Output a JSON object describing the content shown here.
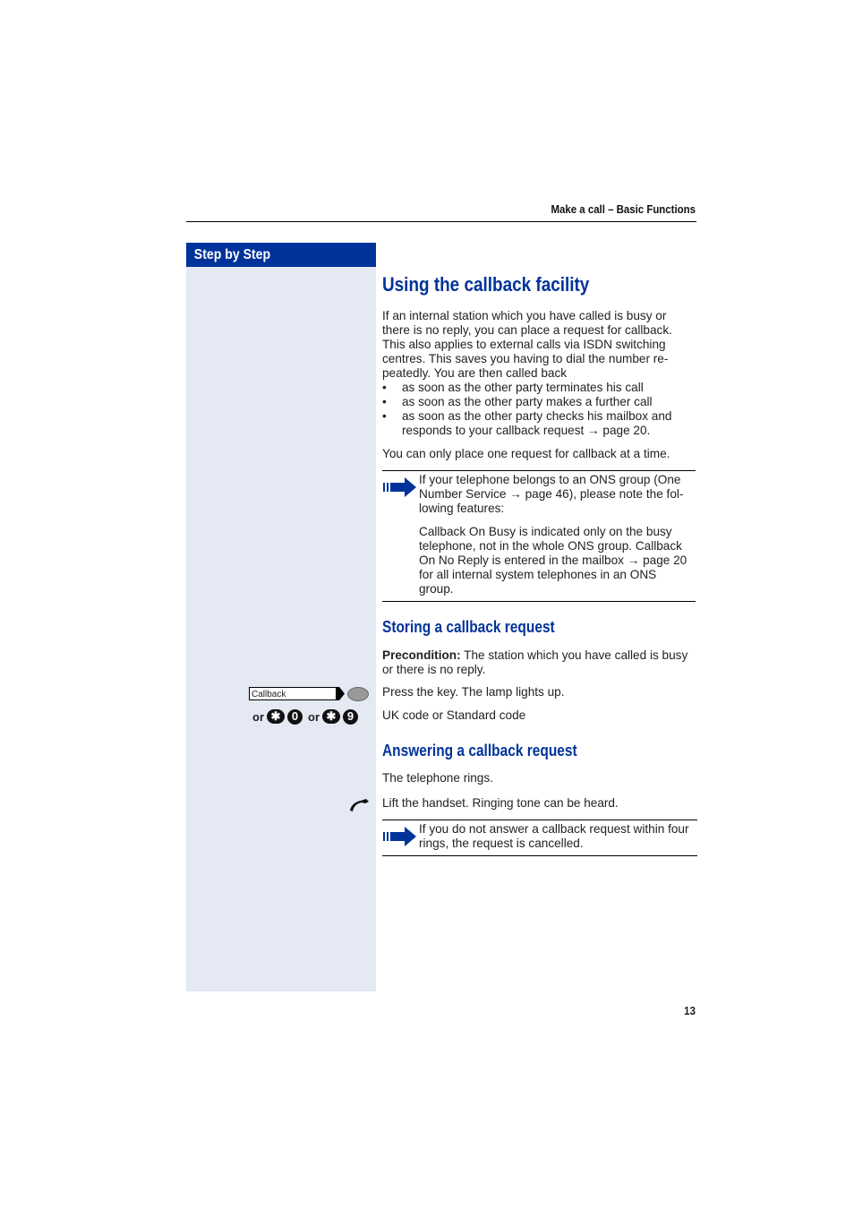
{
  "header": {
    "section_title": "Make a call – Basic Functions"
  },
  "sidebar": {
    "title": "Step by Step",
    "callback_key_label": "Callback",
    "code_or_1": "or",
    "code_or_2": "or",
    "codes": [
      {
        "star": "✱",
        "digit": "0"
      },
      {
        "star": "✱",
        "digit": "9"
      }
    ]
  },
  "main": {
    "title": "Using the callback facility",
    "intro": "If an internal station which you have called is busy or there is no reply, you can place a request for callback. This also applies to external calls via ISDN switching centres. This saves you having to dial the number re-peatedly. You are then called back",
    "bullets": [
      "as soon as the other party terminates his call",
      "as soon as the other party makes a further call",
      "as soon as the other party checks his mailbox and responds to your callback request → page 20."
    ],
    "single_request_note": "You can only place one request for callback at a time.",
    "ons_note": {
      "line1": "If your telephone belongs to an ONS group (One Number Service → page 46), please note the fol-lowing features:",
      "line2": "Callback On Busy is indicated only on the busy telephone, not in the whole ONS group. Callback On No Reply is entered in the mailbox → page 20 for all internal system telephones in an ONS group."
    },
    "storing": {
      "title": "Storing a callback request",
      "precondition_label": "Precondition:",
      "precondition_text": " The station which you have called is busy or there is no reply.",
      "step_key": "Press the key. The lamp lights up.",
      "step_code": "UK code or Standard code"
    },
    "answering": {
      "title": "Answering a callback request",
      "rings": "The telephone rings.",
      "lift": "Lift the handset. Ringing tone can be heard.",
      "note": "If you do not answer a callback request within four rings, the request is cancelled."
    }
  },
  "footer": {
    "page_number": "13"
  }
}
